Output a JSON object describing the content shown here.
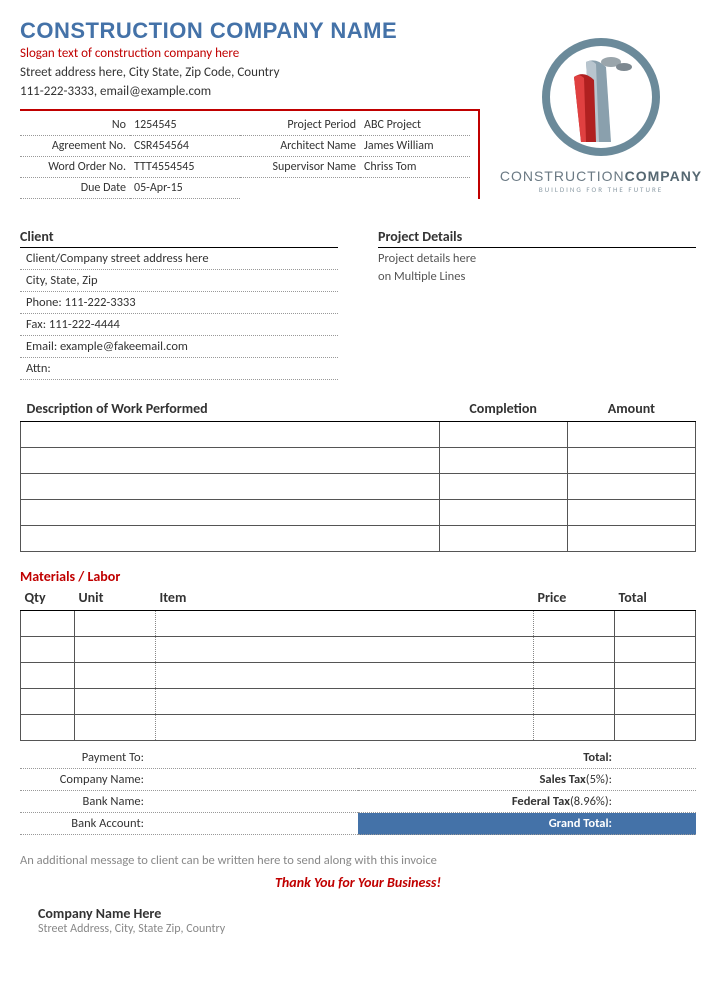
{
  "header": {
    "company_name": "CONSTRUCTION COMPANY NAME",
    "slogan": "Slogan text of construction company here",
    "address": "Street address here, City State, Zip Code, Country",
    "contact": "111-222-3333, email@example.com"
  },
  "logo": {
    "brand_a": "CONSTRUCTION",
    "brand_b": "COMPANY",
    "tagline": "BUILDING FOR THE FUTURE"
  },
  "meta": {
    "no_label": "No",
    "no_value": "1254545",
    "period_label": "Project Period",
    "period_value": "ABC Project",
    "agreement_label": "Agreement No.",
    "agreement_value": "CSR454564",
    "architect_label": "Architect Name",
    "architect_value": "James William",
    "order_label": "Word Order No.",
    "order_value": "TTT4554545",
    "supervisor_label": "Supervisor Name",
    "supervisor_value": "Chriss Tom",
    "due_label": "Due Date",
    "due_value": "05-Apr-15"
  },
  "client": {
    "title": "Client",
    "lines": {
      "l1": "Client/Company street address here",
      "l2": "City, State, Zip",
      "l3": "Phone: 111-222-3333",
      "l4": "Fax: 111-222-4444",
      "l5": "Email: example@fakeemail.com",
      "l6": "Attn:"
    }
  },
  "project": {
    "title": "Project Details",
    "line1": "Project details here",
    "line2": "on Multiple Lines"
  },
  "work": {
    "h_desc": "Description of Work Performed",
    "h_comp": "Completion",
    "h_amt": "Amount"
  },
  "materials": {
    "title": "Materials / Labor",
    "h_qty": "Qty",
    "h_unit": "Unit",
    "h_item": "Item",
    "h_price": "Price",
    "h_total": "Total"
  },
  "payment": {
    "to": "Payment To:",
    "company": "Company Name:",
    "bank": "Bank Name:",
    "account": "Bank Account:"
  },
  "totals": {
    "total": "Total:",
    "sales_tax": "Sales Tax",
    "sales_pct": " (5%):",
    "fed_tax": "Federal Tax",
    "fed_pct": " (8.96%):",
    "grand": "Grand Total:"
  },
  "footer": {
    "msg": "An additional message to client can be written here to send along with this invoice",
    "thanks": "Thank You for Your Business!",
    "company": "Company Name Here",
    "address": "Street Address, City, State Zip, Country"
  }
}
